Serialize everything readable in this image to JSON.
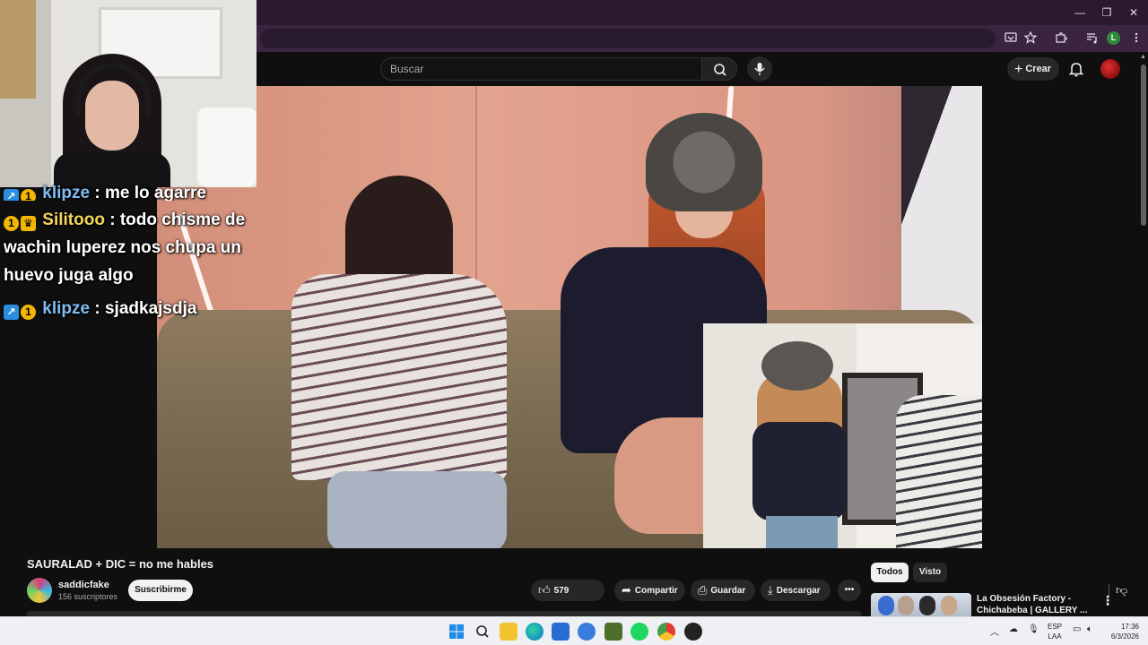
{
  "browser": {
    "window_controls": {
      "minimize": "—",
      "maximize": "❐",
      "close": "✕"
    },
    "toolbar_icons": [
      "cast-icon",
      "star-icon",
      "extensions-icon",
      "media-icon",
      "profile-icon",
      "menu-icon"
    ],
    "profile_initial": "L"
  },
  "masthead": {
    "search_placeholder": "Buscar",
    "create_label": "Crear"
  },
  "chat": {
    "messages": [
      {
        "user": "klipze",
        "text": ": me lo agarre",
        "badges": [
          "sub",
          "gold"
        ]
      },
      {
        "user": "Silitooo",
        "text": ": todo chisme de wachin luperez nos chupa un huevo juga algo",
        "badges": [
          "gold",
          "crown"
        ]
      },
      {
        "user": "klipze",
        "text": ": sjadkajsdja",
        "badges": [
          "sub",
          "gold"
        ]
      }
    ]
  },
  "video": {
    "title": "SAURALAD + DIC = no me hables",
    "channel": "saddicfake",
    "subscribers": "156 suscriptores",
    "subscribe_label": "Suscribirme",
    "likes": "579",
    "share_label": "Compartir",
    "save_label": "Guardar",
    "download_label": "Descargar"
  },
  "sidebar": {
    "chips": [
      "Todos",
      "Visto"
    ],
    "recommended": {
      "title": "La Obsesión Factory - Chichabeba | GALLERY ..."
    }
  },
  "taskbar": {
    "lang_top": "ESP",
    "lang_bottom": "LAA",
    "time": "17:36",
    "date": "6/3/2026"
  },
  "colors": {
    "youtube_bg": "#0f0f0f",
    "browser_frame": "#2b1930",
    "chat_blue_user": "#7fbcf2",
    "chat_gold_user": "#f5d45a"
  }
}
